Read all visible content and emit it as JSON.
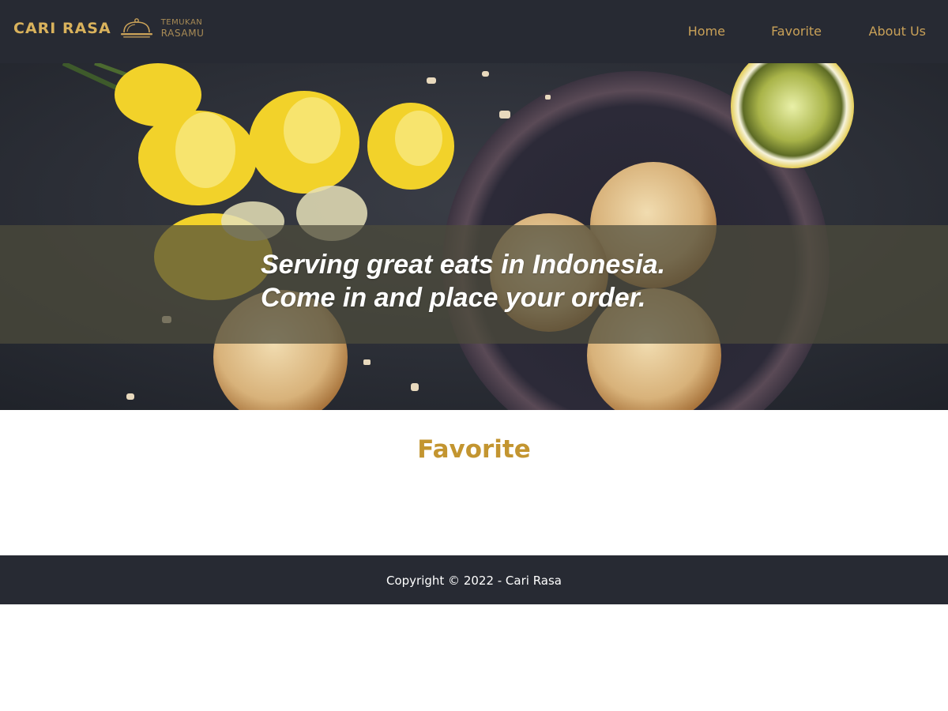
{
  "header": {
    "brand_name": "CARI RASA",
    "tagline_line1": "TEMUKAN",
    "tagline_line2": "RASAMU",
    "nav": [
      {
        "label": "Home"
      },
      {
        "label": "Favorite"
      },
      {
        "label": "About Us"
      }
    ]
  },
  "hero": {
    "line1": "Serving great eats in Indonesia.",
    "line2": "Come in and place your order."
  },
  "main": {
    "section_title": "Favorite"
  },
  "footer": {
    "copyright": "Copyright © 2022 - Cari Rasa"
  },
  "colors": {
    "header_bg": "#272a33",
    "brand_gold": "#d9b25c",
    "nav_gold": "#c9a158",
    "title_gold": "#c39530",
    "footer_bg": "#272a33"
  },
  "icons": {
    "logo": "cloche-icon"
  }
}
